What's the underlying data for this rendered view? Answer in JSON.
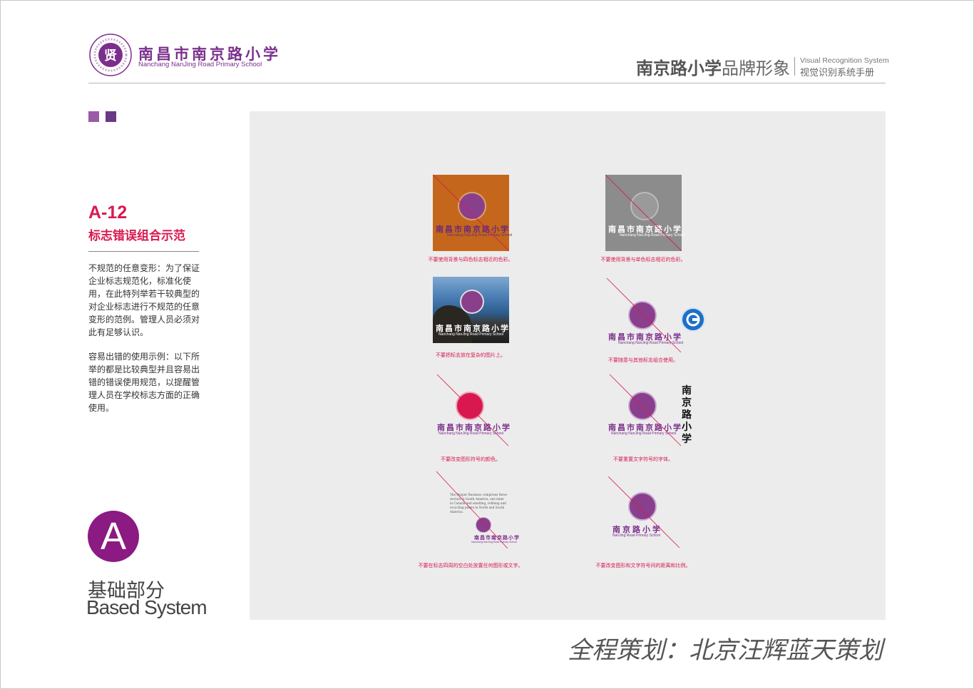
{
  "header": {
    "logo_cn": "南昌市南京路小学",
    "logo_en": "Nanchang NanJing Road Primary School",
    "brand_bold": "南京路小学",
    "brand_rest": "品牌形象",
    "vrs_en": "Visual Recognition System",
    "vrs_cn": "视觉识别系统手册"
  },
  "section": {
    "code": "A-12",
    "title": "标志错误组合示范",
    "para1": "不规范的任意变形：为了保证企业标志规范化，标准化使用，在此特列举若干较典型的对企业标志进行不规范的任意变形的范例。管理人员必须对此有足够认识。",
    "para2": "容易出错的使用示例：以下所举的都是比较典型并且容易出错的错误使用规范，以提醒管理人员在学校标志方面的正确使用。",
    "badge_letter": "A",
    "part_cn": "基础部分",
    "part_en": "Based System"
  },
  "examples": [
    {
      "caption": "不要使用背景与四色标志相近的色彩。"
    },
    {
      "caption": "不要使用背景与单色标志相近的色彩。"
    },
    {
      "caption": "不要把标志放在复杂的图片上。"
    },
    {
      "caption": "不要随意与其他标志组合使用。"
    },
    {
      "caption": "不要改变图形符号的颜色。"
    },
    {
      "caption": "不要重置文字符号的字体。"
    },
    {
      "caption": "不要在标志四周的空白处放置任何图形或文字。"
    },
    {
      "caption": "不要改变图形和文字符号间的距离和比例。"
    }
  ],
  "mini_logo": {
    "cn": "南昌市南京路小学",
    "en": "Nanchang NanJing Road Primary School",
    "cn_short": "南京路小学",
    "en_short": "NanJing Road Primary School",
    "vertical_cn": "南京路小学"
  },
  "filler_text": "The Pepper Business comprises three sectors in South America, one mine in Canada and smelting, refining and recycling plants in North and South America.",
  "footer": "全程策划：北京汪辉蓝天策划",
  "colors": {
    "brand_purple": "#7b2f8c",
    "accent_red": "#d8194f",
    "panel_gray": "#ececec"
  }
}
